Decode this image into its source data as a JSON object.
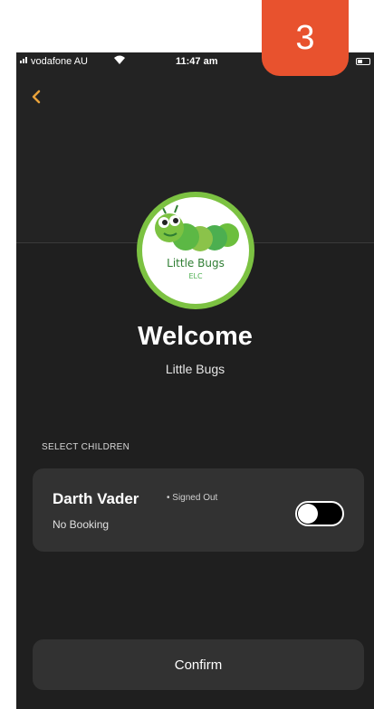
{
  "status_bar": {
    "carrier": "vodafone AU",
    "wifi_icon": "wifi-icon",
    "time": "11:47 am"
  },
  "header": {
    "back_icon": "chevron-left-icon"
  },
  "logo": {
    "name": "Little Bugs",
    "sub": "ELC"
  },
  "welcome": {
    "title": "Welcome",
    "centre": "Little Bugs"
  },
  "children_section": {
    "label": "SELECT CHILDREN",
    "children": [
      {
        "name": "Darth Vader",
        "status": "• Signed Out",
        "booking": "No Booking",
        "selected": false
      }
    ]
  },
  "footer": {
    "confirm_label": "Confirm"
  },
  "step_badge": {
    "number": "3"
  },
  "colors": {
    "background": "#1f1f1f",
    "card": "#323232",
    "accent": "#e8a23a",
    "badge": "#e8522e",
    "logo_green": "#7cc242"
  }
}
